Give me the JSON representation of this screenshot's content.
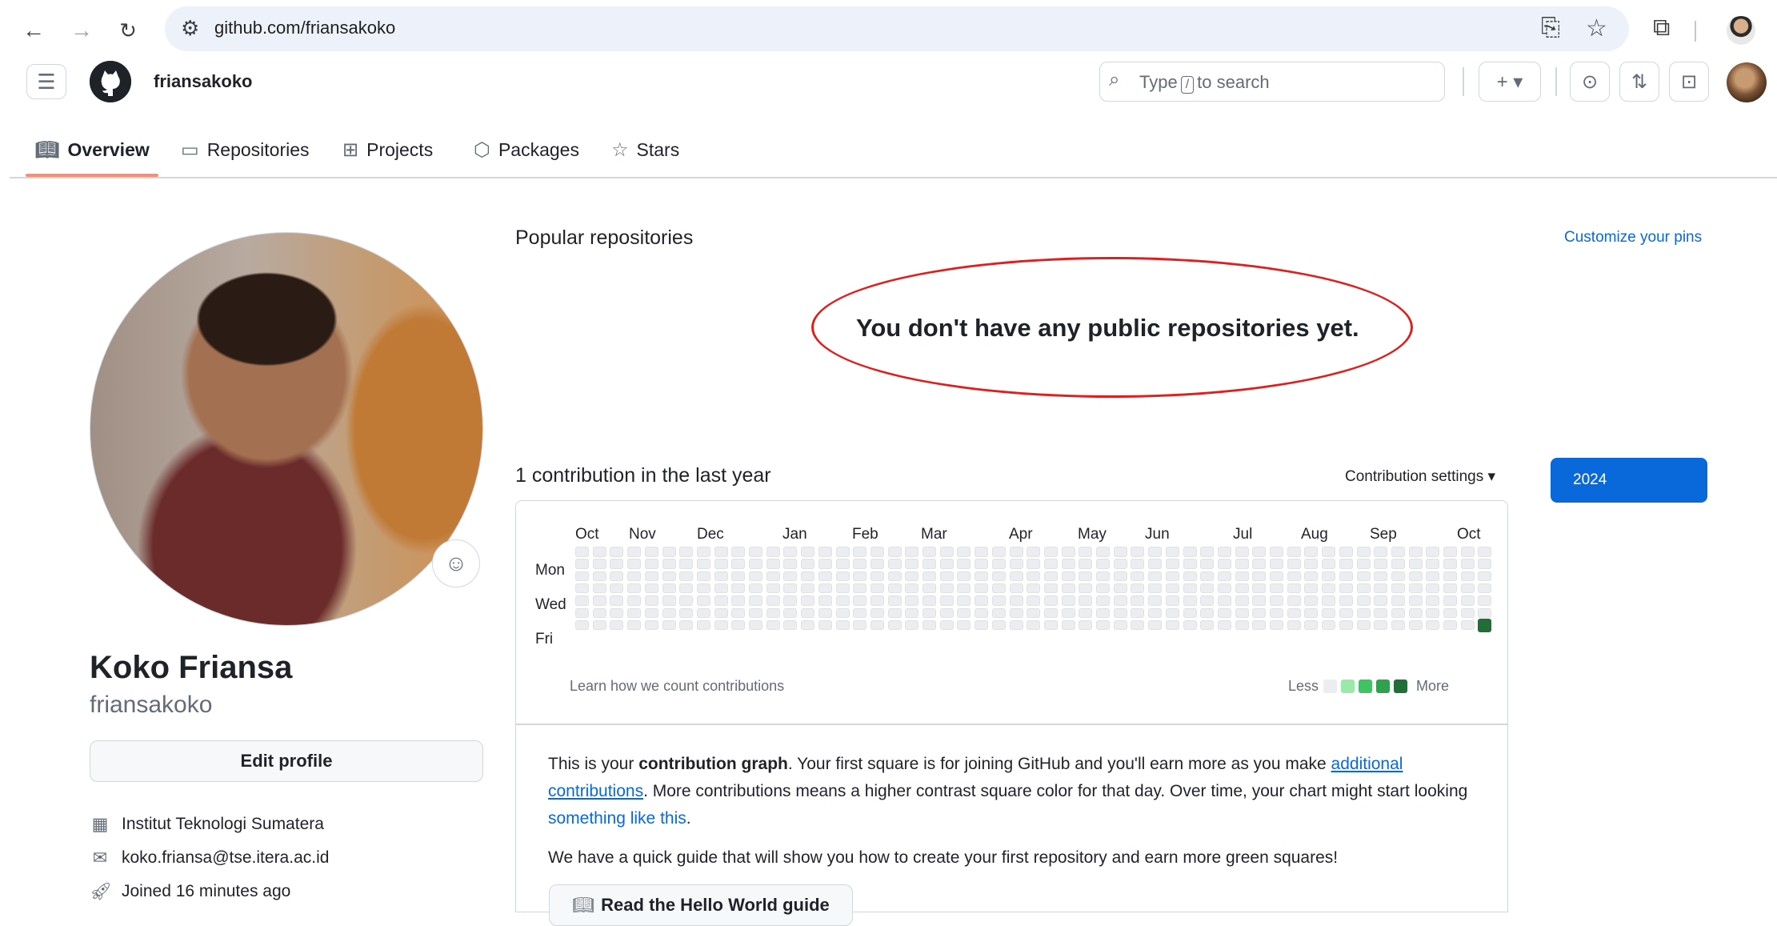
{
  "browser": {
    "url": "github.com/friansakoko"
  },
  "header": {
    "username": "friansakoko",
    "search": {
      "prefix": "Type",
      "key": "/",
      "suffix": "to search"
    },
    "create_label": "+ ▾"
  },
  "tabs": [
    {
      "label": "Overview",
      "icon": "book-icon"
    },
    {
      "label": "Repositories",
      "icon": "repo-icon"
    },
    {
      "label": "Projects",
      "icon": "table-icon"
    },
    {
      "label": "Packages",
      "icon": "package-icon"
    },
    {
      "label": "Stars",
      "icon": "star-icon"
    }
  ],
  "profile": {
    "display_name": "Koko Friansa",
    "login": "friansakoko",
    "edit_label": "Edit profile",
    "organization": "Institut Teknologi Sumatera",
    "email": "koko.friansa@tse.itera.ac.id",
    "joined": "Joined 16 minutes ago"
  },
  "popular": {
    "title": "Popular repositories",
    "customize": "Customize your pins",
    "empty_message": "You don't have any public repositories yet."
  },
  "contributions": {
    "title": "1 contribution in the last year",
    "settings_label": "Contribution settings ▾",
    "year": "2024",
    "months": [
      "Oct",
      "Nov",
      "Dec",
      "Jan",
      "Feb",
      "Mar",
      "Apr",
      "May",
      "Jun",
      "Jul",
      "Aug",
      "Sep",
      "Oct"
    ],
    "day_labels": [
      "Mon",
      "Wed",
      "Fri"
    ],
    "weeks": 53,
    "days_per_week": 7,
    "active_cell": {
      "week": 52,
      "day": 6,
      "level": 4
    },
    "learn_link": "Learn how we count contributions",
    "legend_less": "Less",
    "legend_more": "More",
    "level_colors": [
      "#ebedf0",
      "#9be9a8",
      "#40c463",
      "#30a14e",
      "#216e39"
    ]
  },
  "info": {
    "p1_a": "This is your ",
    "p1_b": "contribution graph",
    "p1_c": ". Your first square is for joining GitHub and you'll earn more as you make ",
    "p1_link1": "additional contributions",
    "p1_d": ". More contributions means a higher contrast square color for that day. Over time, your chart might start looking ",
    "p1_link2": "something like this",
    "p1_e": ".",
    "p2": "We have a quick guide that will show you how to create your first repository and earn more green squares!",
    "hello_button": "Read the Hello World guide"
  },
  "colors": {
    "accent": "#0969da",
    "tab_underline": "#fd8c73",
    "annotation": "#e01e1e"
  }
}
